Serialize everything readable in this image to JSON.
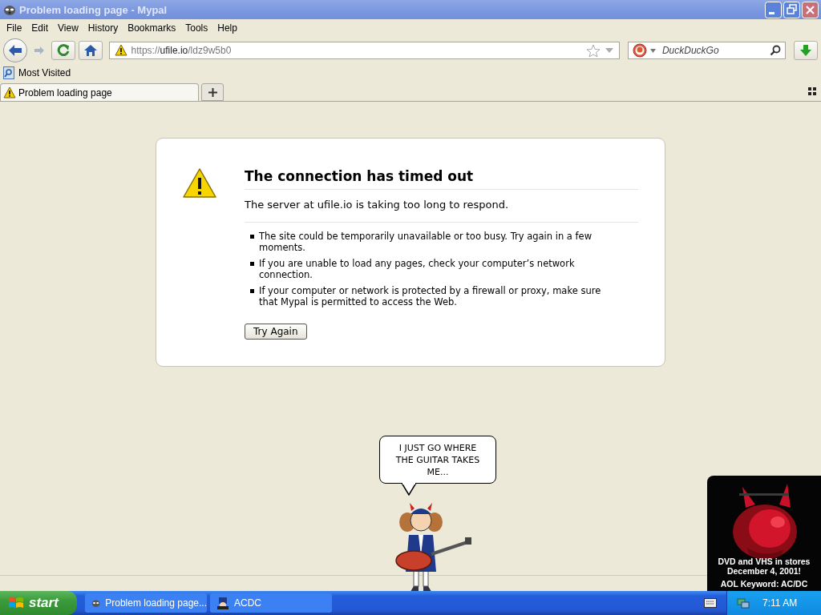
{
  "window": {
    "title": "Problem loading page - Mypal"
  },
  "menu": [
    {
      "label": "File"
    },
    {
      "label": "Edit"
    },
    {
      "label": "View"
    },
    {
      "label": "History"
    },
    {
      "label": "Bookmarks"
    },
    {
      "label": "Tools"
    },
    {
      "label": "Help"
    }
  ],
  "address": {
    "scheme": "https://",
    "host": "ufile.io",
    "path": "/ldz9w5b0"
  },
  "search": {
    "placeholder": "DuckDuckGo"
  },
  "bookmarks": [
    {
      "label": "Most Visited"
    }
  ],
  "tabs": [
    {
      "label": "Problem loading page",
      "selected": true
    }
  ],
  "error": {
    "title": "The connection has timed out",
    "message": "The server at ufile.io is taking too long to respond.",
    "bullets": [
      "The site could be temporarily unavailable or too busy. Try again in a few moments.",
      "If you are unable to load any pages, check your computer’s network connection.",
      "If your computer or network is protected by a firewall or proxy, make sure that Mypal is permitted to access the Web."
    ],
    "button": "Try Again"
  },
  "mascot": {
    "speech": "I JUST GO WHERE THE GUITAR TAKES ME..."
  },
  "ad": {
    "kind": "picture",
    "captions": [
      "DVD and VHS in stores December 4, 2001!",
      "AOL Keyword: AC/DC"
    ]
  },
  "taskbar": {
    "start": "start",
    "tasks": [
      {
        "label": "Problem loading page..."
      },
      {
        "label": "ACDC"
      }
    ],
    "clock": "7:11 AM"
  }
}
